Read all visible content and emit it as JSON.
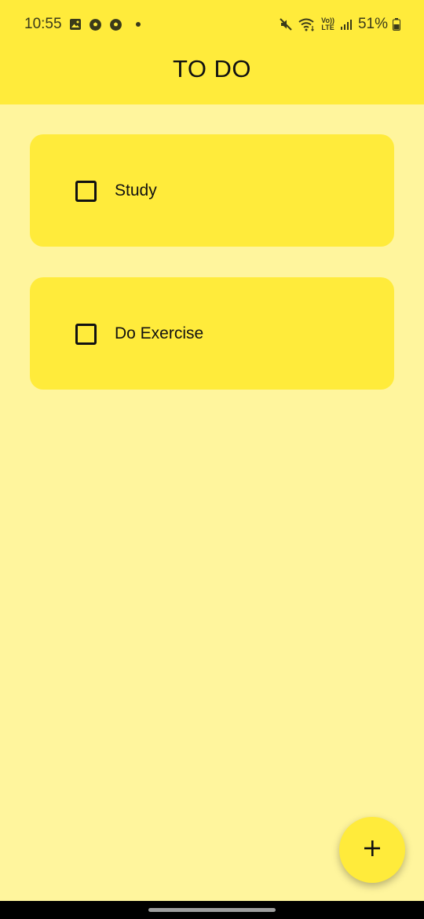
{
  "status_bar": {
    "time": "10:55",
    "left_icons": [
      "gallery-icon",
      "soccer-ball-icon",
      "soccer-ball-icon",
      "dot-icon"
    ],
    "right_icons": [
      "mute-icon",
      "wifi-icon",
      "volte-icon",
      "signal-icon",
      "battery-icon"
    ],
    "volte_top": "Vo))",
    "volte_bottom": "LTE",
    "battery": "51%"
  },
  "header": {
    "title": "TO DO",
    "background": "#ffeb3b"
  },
  "tasks": [
    {
      "label": "Study",
      "checked": false
    },
    {
      "label": "Do Exercise",
      "checked": false
    }
  ],
  "fab": {
    "icon": "plus-icon",
    "label": "+"
  },
  "colors": {
    "page_background": "#fff59d",
    "card_background": "#ffeb3b",
    "accent": "#ffeb3b",
    "text": "#111111"
  }
}
